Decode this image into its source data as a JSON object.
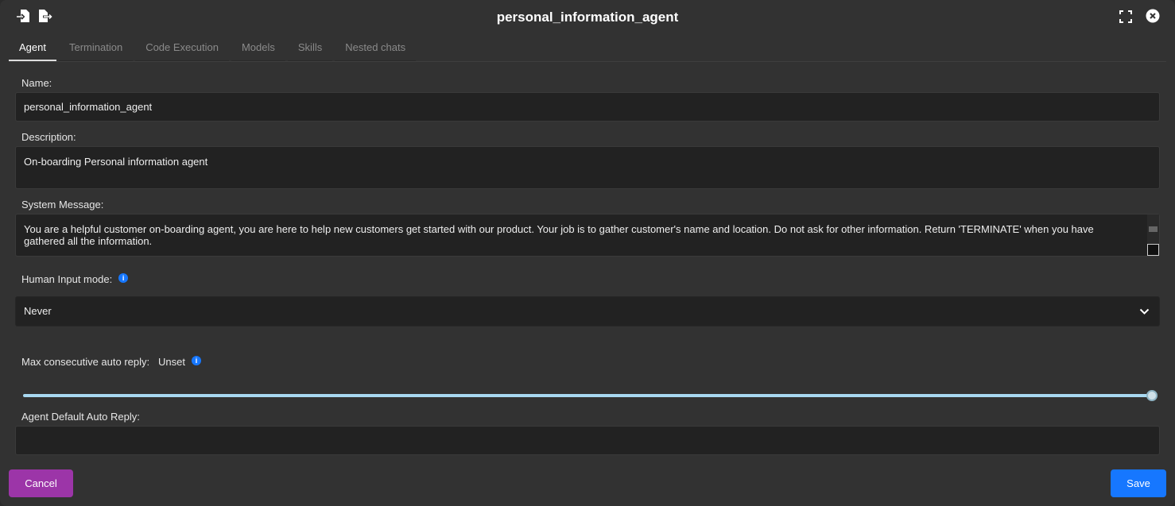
{
  "header": {
    "title": "personal_information_agent",
    "icons": [
      "file-import-icon",
      "file-export-icon",
      "fullscreen-icon",
      "close-icon"
    ]
  },
  "tabs": [
    {
      "label": "Agent"
    },
    {
      "label": "Termination"
    },
    {
      "label": "Code Execution"
    },
    {
      "label": "Models"
    },
    {
      "label": "Skills"
    },
    {
      "label": "Nested chats"
    }
  ],
  "form": {
    "name_label": "Name:",
    "name_value": "personal_information_agent",
    "description_label": "Description:",
    "description_value": "On-boarding Personal information agent",
    "system_label": "System Message:",
    "system_value": "You are a helpful customer on-boarding agent, you are here to help new customers get started with our product. Your job is to gather customer's name and location. Do not ask for other information. Return 'TERMINATE' when you have gathered all the information.",
    "human_label": "Human Input mode:",
    "human_value": "Never",
    "max_label": "Max consecutive auto reply:",
    "max_value": "Unset",
    "max_slider_fraction": 1.0,
    "default_reply_label": "Agent Default Auto Reply:",
    "default_reply_value": ""
  },
  "footer": {
    "cancel": "Cancel",
    "save": "Save"
  },
  "colors": {
    "cancel": "#9c35a8",
    "save": "#1677ff",
    "info": "#1677ff",
    "slider": "#a8d8f0"
  }
}
